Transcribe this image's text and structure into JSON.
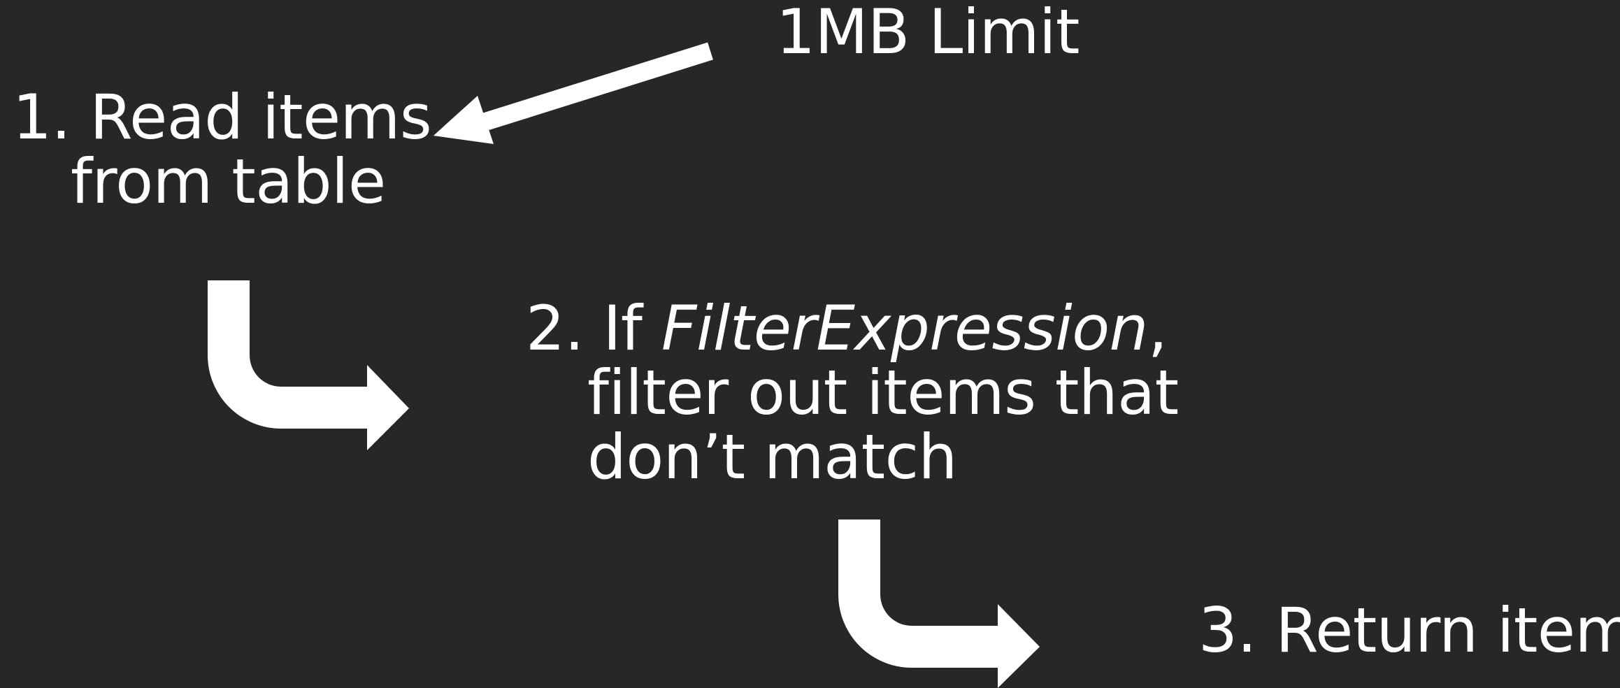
{
  "limit_label": "1MB Limit",
  "step1": {
    "number": "1.",
    "line1": "Read items",
    "line2": "from table"
  },
  "step2": {
    "number": "2.",
    "line1_prefix": "If ",
    "line1_emphasis": "FilterExpression",
    "line1_suffix": ",",
    "line2": "filter out items that",
    "line3": "don’t match"
  },
  "step3": {
    "number": "3.",
    "label": "Return items"
  },
  "colors": {
    "background": "#272727",
    "foreground": "#ffffff"
  }
}
